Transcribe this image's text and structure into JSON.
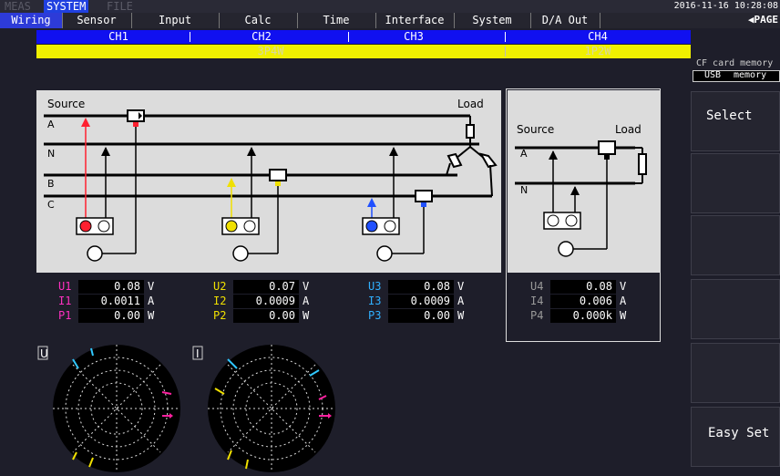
{
  "mode_bar": {
    "meas": "MEAS",
    "system": "SYSTEM",
    "file": "FILE",
    "datetime": "2016-11-16 10:28:08"
  },
  "tabs": [
    "Wiring",
    "Sensor",
    "Input",
    "Calc",
    "Time",
    "Interface",
    "System",
    "D/A Out"
  ],
  "page_label": "PAGE",
  "channels": {
    "ch1": "CH1",
    "ch2": "CH2",
    "ch3": "CH3",
    "ch4": "CH4",
    "wiring_a": "3P4W",
    "wiring_b": "1P2W"
  },
  "diagram3": {
    "source": "Source",
    "load": "Load",
    "a": "A",
    "n": "N",
    "b": "B",
    "c": "C"
  },
  "diagram1": {
    "source": "Source",
    "load": "Load",
    "a": "A",
    "n": "N"
  },
  "meas": {
    "ch1": [
      {
        "label": "U1",
        "value": "0.08",
        "unit": "V"
      },
      {
        "label": "I1",
        "value": "0.0011",
        "unit": "A"
      },
      {
        "label": "P1",
        "value": "0.00",
        "unit": "W"
      }
    ],
    "ch2": [
      {
        "label": "U2",
        "value": "0.07",
        "unit": "V"
      },
      {
        "label": "I2",
        "value": "0.0009",
        "unit": "A"
      },
      {
        "label": "P2",
        "value": "0.00",
        "unit": "W"
      }
    ],
    "ch3": [
      {
        "label": "U3",
        "value": "0.08",
        "unit": "V"
      },
      {
        "label": "I3",
        "value": "0.0009",
        "unit": "A"
      },
      {
        "label": "P3",
        "value": "0.00",
        "unit": "W"
      }
    ],
    "ch4": [
      {
        "label": "U4",
        "value": "0.08",
        "unit": "V"
      },
      {
        "label": "I4",
        "value": "0.006",
        "unit": "A"
      },
      {
        "label": "P4",
        "value": "0.000k",
        "unit": "W"
      }
    ]
  },
  "vector": {
    "u_label": "U",
    "i_label": "I"
  },
  "side": {
    "cf": "CF card memory",
    "usb": "USB",
    "memory": "memory",
    "select": "Select",
    "easy_set": "Easy Set"
  },
  "colors": {
    "ch1": "#ff3040",
    "ch2": "#ffe020",
    "ch3": "#2060ff",
    "ch_bar": "#1010f0",
    "wiring_bar": "#f0f000",
    "accent": "#ff20a0",
    "cyan": "#30c8ff"
  }
}
